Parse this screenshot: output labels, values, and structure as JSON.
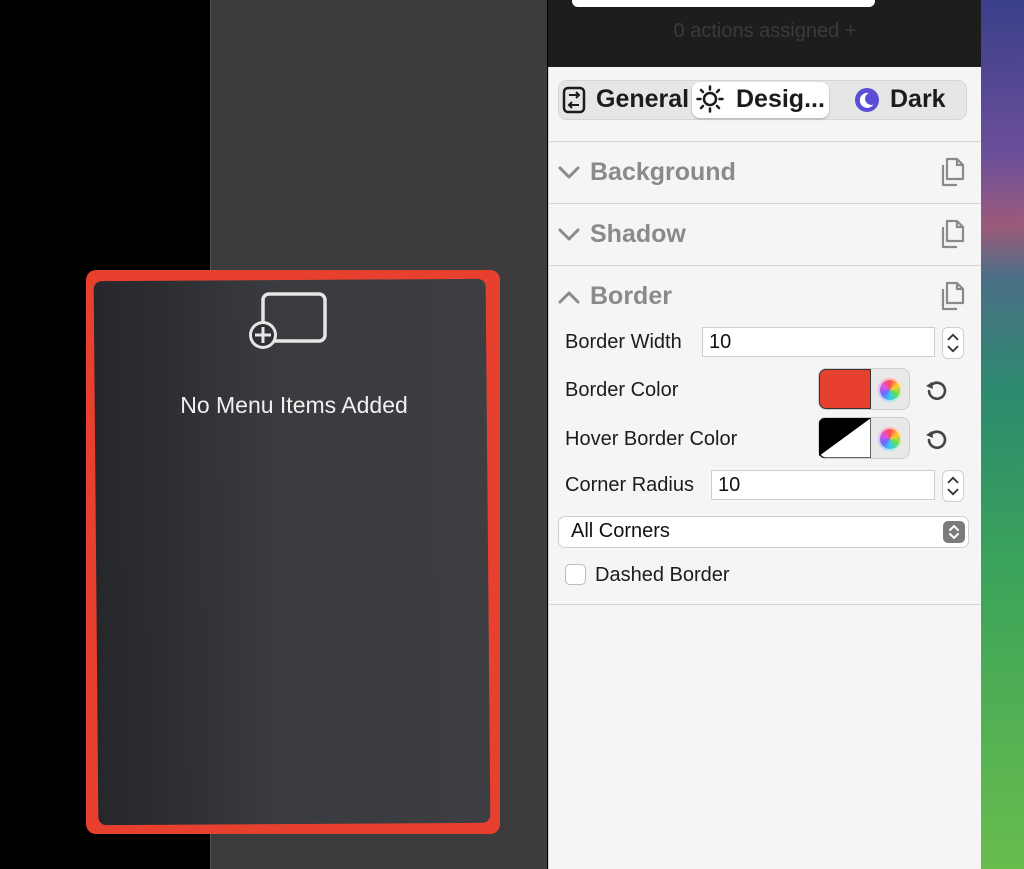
{
  "preview": {
    "empty_label": "No Menu Items Added",
    "border_color": "#e8402f"
  },
  "inspector": {
    "actions_assigned": "0 actions assigned +",
    "tabs": [
      {
        "label": "General",
        "icon": "phone-rotate-icon",
        "selected": false
      },
      {
        "label": "Desig...",
        "icon": "sun-icon",
        "selected": true
      },
      {
        "label": "Dark",
        "icon": "moon-icon",
        "selected": false
      }
    ],
    "sections": {
      "background": {
        "title": "Background",
        "expanded": false
      },
      "shadow": {
        "title": "Shadow",
        "expanded": false
      },
      "border": {
        "title": "Border",
        "expanded": true
      }
    },
    "border": {
      "width_label": "Border Width",
      "width_value": "10",
      "color_label": "Border Color",
      "color_value": "#e8402f",
      "hover_color_label": "Hover Border Color",
      "radius_label": "Corner Radius",
      "radius_value": "10",
      "corners_selected": "All Corners",
      "dashed_label": "Dashed Border",
      "dashed_checked": false
    }
  }
}
